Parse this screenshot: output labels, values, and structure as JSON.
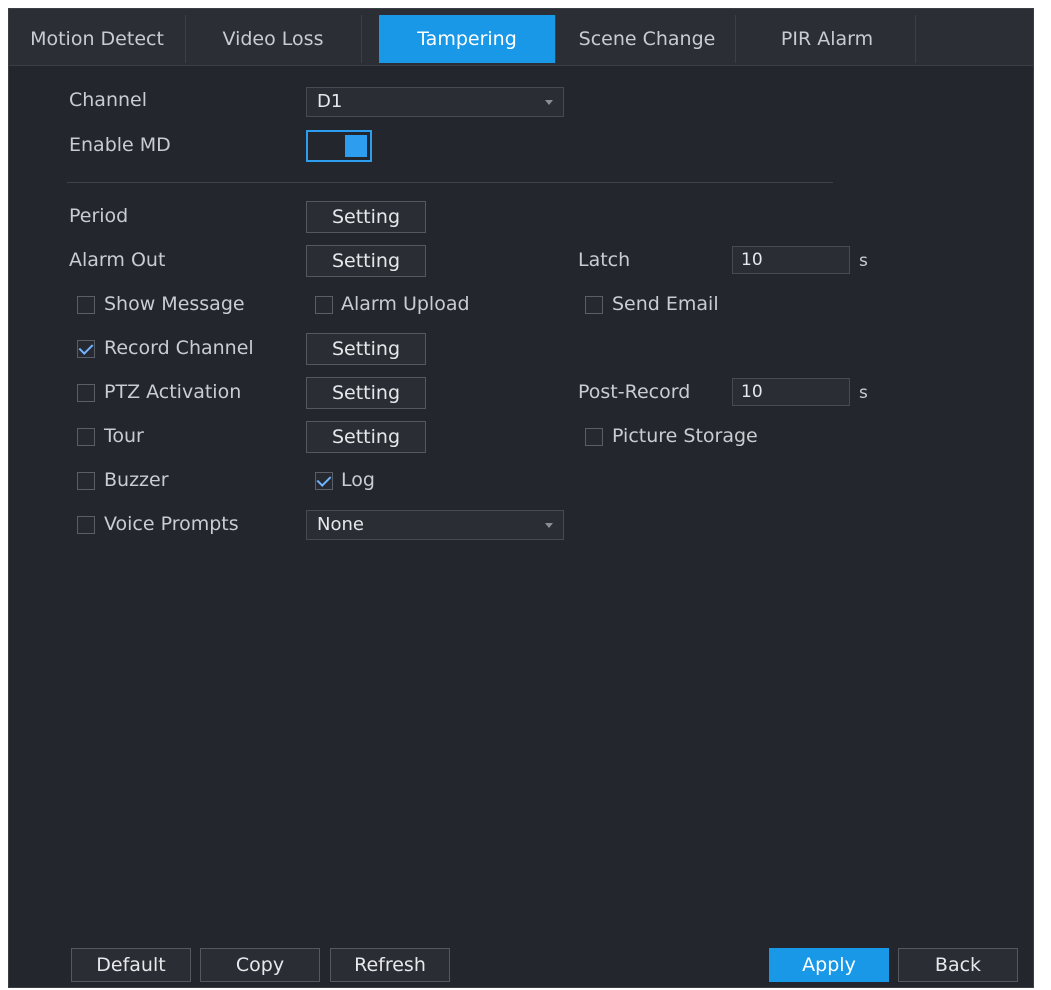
{
  "tabs": [
    {
      "label": "Motion Detect",
      "active": false
    },
    {
      "label": "Video Loss",
      "active": false
    },
    {
      "label": "Tampering",
      "active": true
    },
    {
      "label": "Scene Change",
      "active": false
    },
    {
      "label": "PIR Alarm",
      "active": false
    }
  ],
  "form": {
    "channel": {
      "label": "Channel",
      "value": "D1"
    },
    "enable_md": {
      "label": "Enable MD",
      "on": true
    },
    "period": {
      "label": "Period",
      "button": "Setting"
    },
    "alarm_out": {
      "label": "Alarm Out",
      "button": "Setting"
    },
    "latch": {
      "label": "Latch",
      "value": "10",
      "unit": "s"
    },
    "show_message": {
      "label": "Show Message",
      "checked": false
    },
    "alarm_upload": {
      "label": "Alarm Upload",
      "checked": false
    },
    "send_email": {
      "label": "Send Email",
      "checked": false
    },
    "record_channel": {
      "label": "Record Channel",
      "checked": true,
      "button": "Setting"
    },
    "ptz_activation": {
      "label": "PTZ Activation",
      "checked": false,
      "button": "Setting"
    },
    "post_record": {
      "label": "Post-Record",
      "value": "10",
      "unit": "s"
    },
    "tour": {
      "label": "Tour",
      "checked": false,
      "button": "Setting"
    },
    "picture_storage": {
      "label": "Picture Storage",
      "checked": false
    },
    "buzzer": {
      "label": "Buzzer",
      "checked": false
    },
    "log": {
      "label": "Log",
      "checked": true
    },
    "voice_prompts": {
      "label": "Voice Prompts",
      "checked": false,
      "value": "None"
    }
  },
  "footer": {
    "default": "Default",
    "copy": "Copy",
    "refresh": "Refresh",
    "apply": "Apply",
    "back": "Back"
  },
  "colors": {
    "accent": "#1a98e8",
    "background": "#23262c",
    "check": "#6fb5ff"
  }
}
